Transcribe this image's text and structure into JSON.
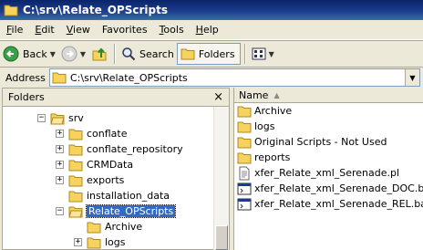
{
  "window": {
    "title": "C:\\srv\\Relate_OPScripts"
  },
  "menu": {
    "items": [
      {
        "label": "File",
        "accel": "F",
        "rest": "ile"
      },
      {
        "label": "Edit",
        "accel": "E",
        "rest": "dit"
      },
      {
        "label": "View",
        "accel": "V",
        "rest": "iew"
      },
      {
        "label": "Favorites",
        "accel": "",
        "rest": "Favorites"
      },
      {
        "label": "Tools",
        "accel": "T",
        "rest": "ools"
      },
      {
        "label": "Help",
        "accel": "H",
        "rest": "elp"
      }
    ]
  },
  "toolbar": {
    "back_label": "Back",
    "search_label": "Search",
    "folders_label": "Folders"
  },
  "address": {
    "label": "Address",
    "label_accel": "d",
    "value": "C:\\srv\\Relate_OPScripts"
  },
  "folders_pane": {
    "title": "Folders",
    "close_glyph": "×",
    "tree": [
      {
        "label": "srv",
        "expander": "minus"
      },
      {
        "label": "conflate",
        "expander": "plus"
      },
      {
        "label": "conflate_repository",
        "expander": "plus"
      },
      {
        "label": "CRMData",
        "expander": "plus"
      },
      {
        "label": "exports",
        "expander": "plus"
      },
      {
        "label": "installation_data",
        "expander": "none"
      },
      {
        "label": "Relate_OPScripts",
        "expander": "minus",
        "selected": true
      },
      {
        "label": "Archive",
        "expander": "none"
      },
      {
        "label": "logs",
        "expander": "plus"
      }
    ]
  },
  "files_pane": {
    "column_header": "Name",
    "items": [
      {
        "name": "Archive",
        "icon": "folder-icon"
      },
      {
        "name": "logs",
        "icon": "folder-icon"
      },
      {
        "name": "Original Scripts - Not Used",
        "icon": "folder-icon"
      },
      {
        "name": "reports",
        "icon": "folder-icon"
      },
      {
        "name": "xfer_Relate_xml_Serenade.pl",
        "icon": "document-icon"
      },
      {
        "name": "xfer_Relate_xml_Serenade_DOC.bat",
        "icon": "batch-file-icon"
      },
      {
        "name": "xfer_Relate_xml_Serenade_REL.bat",
        "icon": "batch-file-icon"
      }
    ]
  },
  "colors": {
    "title_bar": "#0a246a",
    "selection": "#316ac5",
    "folder": "#f5d35e"
  }
}
